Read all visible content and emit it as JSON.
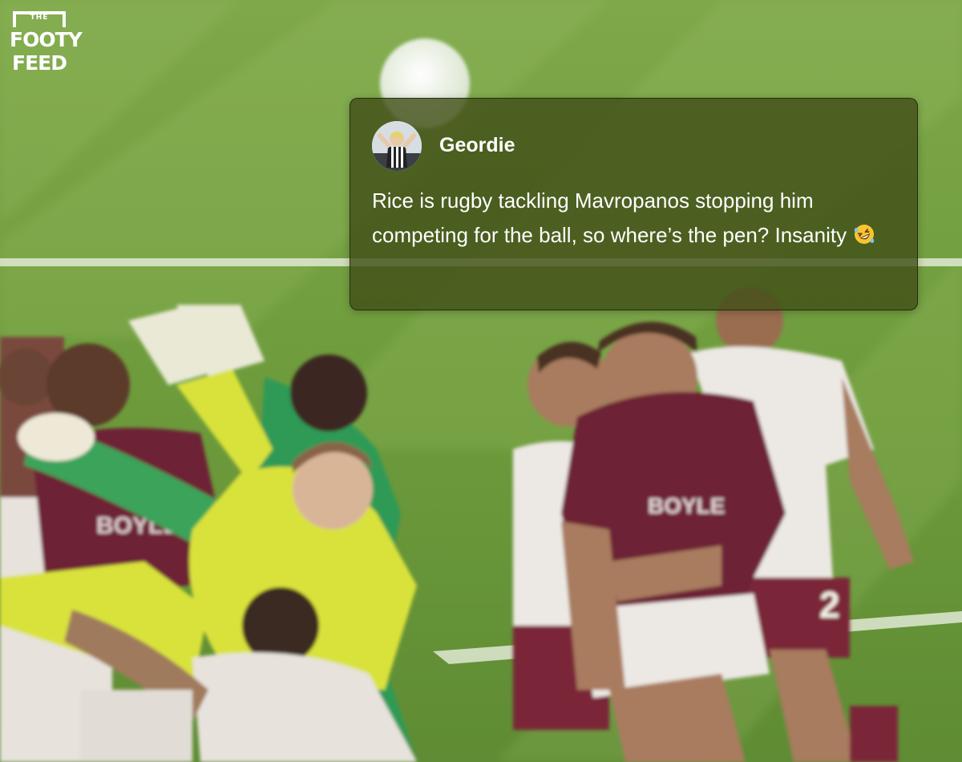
{
  "brand": {
    "logo_small": "THE",
    "logo_line1": "FOOTY",
    "logo_line2": "FEED"
  },
  "tweet": {
    "author": "Geordie",
    "text": "Rice is rugby tackling Mavropanos stopping him competing for the ball, so where’s the pen? Insanity",
    "emoji_icon": "rolling-on-floor-laughing-emoji"
  },
  "photo": {
    "subject": "football-match-penalty-area-scramble",
    "colors": {
      "pitch_light": "#8fb45a",
      "pitch_dark": "#5d8a34",
      "claret": "#6d2335",
      "keeper_yellow": "#d9e23a",
      "keeper_green": "#3aa35a",
      "away_white": "#e9e4df"
    }
  }
}
